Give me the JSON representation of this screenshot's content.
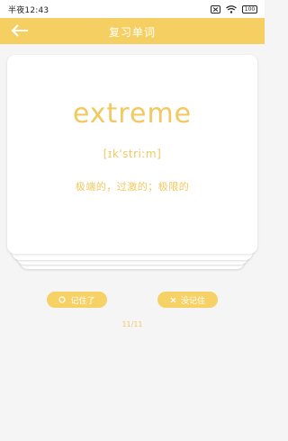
{
  "status_bar": {
    "time": "半夜12:43",
    "battery": "100",
    "icons": [
      "notification-off-icon",
      "wifi-icon",
      "battery-icon"
    ]
  },
  "header": {
    "title": "复习单词",
    "back_icon": "arrow-left-icon"
  },
  "card": {
    "word": "extreme",
    "phonetic": "[ɪk'striːm]",
    "meaning": "极端的，过激的；极限的"
  },
  "actions": {
    "remembered_label": "记住了",
    "remembered_icon": "circle-icon",
    "not_remembered_label": "没记住",
    "not_remembered_icon": "x-icon"
  },
  "progress": {
    "text": "11/11"
  },
  "colors": {
    "accent": "#f6cf63",
    "text_accent": "#f2c860",
    "background": "#f5f5f5",
    "card": "#ffffff"
  }
}
